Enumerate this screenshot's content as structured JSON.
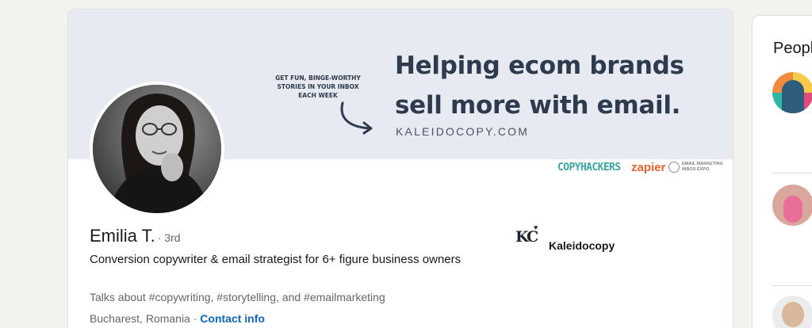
{
  "banner": {
    "headline_line1": "Helping ecom brands",
    "headline_line2": "sell more with email.",
    "url": "KALEIDOCOPY.COM",
    "sub_line1": "GET FUN, BINGE-WORTHY",
    "sub_line2": "STORIES IN YOUR INBOX",
    "sub_line3": "EACH WEEK",
    "logos": {
      "copyhackers": "COPYHACKERS",
      "zapier": "zapier",
      "inbox_expo_line1": "EMAIL MARKETING",
      "inbox_expo_line2": "INBOX EXPO"
    }
  },
  "profile": {
    "name": "Emilia T.",
    "degree": "· 3rd",
    "headline": "Conversion copywriter & email strategist for 6+ figure business owners",
    "talks_about": "Talks about #copywriting, #storytelling, and #emailmarketing",
    "location": "Bucharest, Romania",
    "separator": " · ",
    "contact_info_label": "Contact info"
  },
  "company": {
    "logo_text": "KC",
    "name": "Kaleidocopy"
  },
  "sidebar": {
    "title": "People also viewed",
    "items": [
      {
        "avatar_icon": "person-avatar"
      },
      {
        "avatar_icon": "person-avatar"
      },
      {
        "avatar_icon": "person-avatar"
      }
    ]
  },
  "colors": {
    "page_bg": "#f4f2ee",
    "banner_bg": "#e7ebf1",
    "link": "#0a66c2",
    "text_primary": "#191919",
    "text_secondary": "#666666"
  }
}
